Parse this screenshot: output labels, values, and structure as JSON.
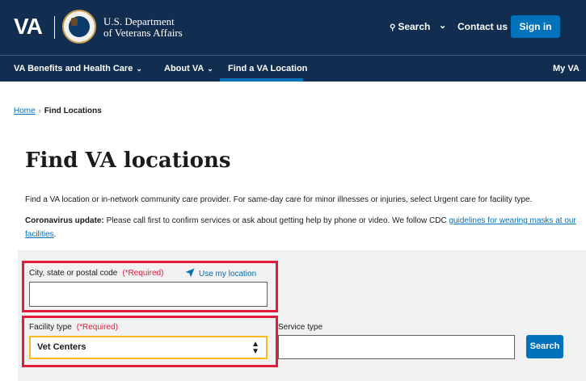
{
  "header": {
    "logo_text": "VA",
    "dept_line1": "U.S. Department",
    "dept_line2": "of Veterans Affairs",
    "search_label": "Search",
    "contact_label": "Contact us",
    "signin_label": "Sign in"
  },
  "nav": {
    "items": [
      {
        "label": "VA Benefits and Health Care",
        "has_dropdown": true
      },
      {
        "label": "About VA",
        "has_dropdown": true
      },
      {
        "label": "Find a VA Location",
        "has_dropdown": false,
        "active": true
      },
      {
        "label": "My VA",
        "has_dropdown": false
      }
    ]
  },
  "breadcrumb": {
    "home": "Home",
    "separator": "›",
    "current": "Find Locations"
  },
  "main": {
    "title": "Find VA locations",
    "intro": "Find a VA location or in-network community care provider. For same-day care for minor illnesses or injuries, select Urgent care for facility type.",
    "covid_bold": "Coronavirus update:",
    "covid_text": " Please call first to confirm services or ask about getting help by phone or video. We follow CDC ",
    "covid_link": "guidelines for wearing masks at our facilities",
    "covid_end": "."
  },
  "form": {
    "city_label": "City, state or postal code",
    "required_text": "(*Required)",
    "use_location": "Use my location",
    "city_value": "",
    "facility_label": "Facility type",
    "facility_value": "Vet Centers",
    "service_label": "Service type",
    "service_value": "",
    "search_button": "Search"
  },
  "colors": {
    "header_bg": "#112e51",
    "primary": "#0071bb",
    "required_red": "#e31c3d",
    "focus_gold": "#fdb81e",
    "panel_bg": "#f1f1f1"
  }
}
